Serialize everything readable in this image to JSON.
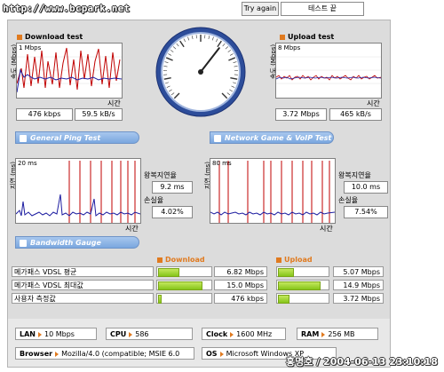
{
  "site_url": "http://www.bcpark.net",
  "buttons": {
    "try_again": "Try again",
    "end_test": "테스트 끝"
  },
  "download_test": {
    "title": "Download test",
    "y_axis": "속도 (Mbps)",
    "top_tick": "1 Mbps",
    "time_label": "시간",
    "kbps": "476 kbps",
    "kBs": "59.5 kB/s"
  },
  "upload_test": {
    "title": "Upload test",
    "y_axis": "속도 (Mbps)",
    "top_tick": "8 Mbps",
    "time_label": "시간",
    "mbps": "3.72 Mbps",
    "kBs": "465 kB/s"
  },
  "gauge": {
    "needle_fraction": 0.64
  },
  "general_ping": {
    "title": "General Ping Test",
    "y_axis": "지연 (ms)",
    "top_tick": "20 ms",
    "time_label": "시간",
    "latency_label": "왕복지연율",
    "latency_value": "9.2 ms",
    "loss_label": "손실율",
    "loss_value": "4.02%"
  },
  "game_voip": {
    "title": "Network Game & VoIP Test",
    "y_axis": "지연 (ms)",
    "top_tick": "80 ms",
    "time_label": "시간",
    "latency_label": "왕복지연율",
    "latency_value": "10.0 ms",
    "loss_label": "손실율",
    "loss_value": "7.54%"
  },
  "bandwidth": {
    "title": "Bandwidth Gauge",
    "download_header": "Download",
    "upload_header": "Upload",
    "rows": [
      {
        "label": "메가패스 VDSL 평균",
        "download": "6.82 Mbps",
        "download_fill": 0.38,
        "upload": "5.07 Mbps",
        "upload_fill": 0.29
      },
      {
        "label": "메가패스 VDSL 최대값",
        "download": "15.0 Mbps",
        "download_fill": 0.82,
        "upload": "14.9 Mbps",
        "upload_fill": 0.82
      },
      {
        "label": "사용자 측정값",
        "download": "476 kbps",
        "download_fill": 0.04,
        "upload": "3.72 Mbps",
        "upload_fill": 0.2
      }
    ]
  },
  "system_info": {
    "lan_label": "LAN",
    "lan_value": "10 Mbps",
    "cpu_label": "CPU",
    "cpu_value": "586",
    "clock_label": "Clock",
    "clock_value": "1600 MHz",
    "ram_label": "RAM",
    "ram_value": "256 MB",
    "browser_label": "Browser",
    "browser_value": "Mozilla/4.0 (compatible; MSIE 6.0",
    "os_label": "OS",
    "os_value": "Microsoft Windows XP"
  },
  "watermark": "홍명호 / 2004-06-13 23:10:18",
  "colors": {
    "series_red": "#c00000",
    "series_blue": "#1c1ca0",
    "header_accent": "#e07a1f",
    "bar_green": "#85c51a",
    "pill_blue": "#7aa7df"
  }
}
